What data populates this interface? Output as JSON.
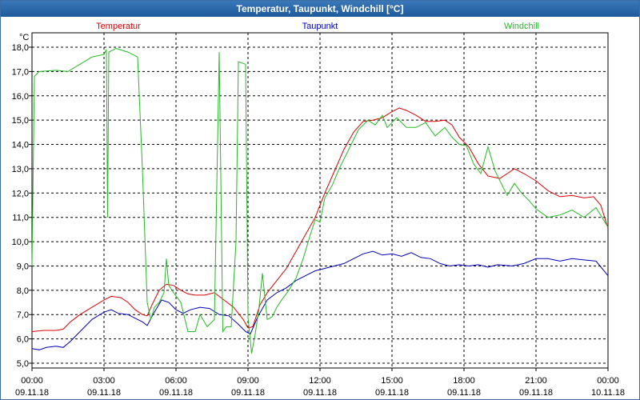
{
  "window": {
    "title": "Temperatur, Taupunkt, Windchill [°C]"
  },
  "chart_data": {
    "type": "line",
    "title": "Temperatur, Taupunkt, Windchill [°C]",
    "ylabel": "°C",
    "xlabel": "",
    "ylim": [
      5.0,
      18.0
    ],
    "xlim": [
      0,
      24
    ],
    "grid": true,
    "legend_placement": "top",
    "y_ticks": [
      "5,0",
      "6,0",
      "7,0",
      "8,0",
      "9,0",
      "10,0",
      "11,0",
      "12,0",
      "13,0",
      "14,0",
      "15,0",
      "16,0",
      "17,0",
      "18,0"
    ],
    "x_ticks": [
      {
        "x": 0,
        "time": "00:00",
        "date": "09.11.18"
      },
      {
        "x": 3,
        "time": "03:00",
        "date": "09.11.18"
      },
      {
        "x": 6,
        "time": "06:00",
        "date": "09.11.18"
      },
      {
        "x": 9,
        "time": "09:00",
        "date": "09.11.18"
      },
      {
        "x": 12,
        "time": "12:00",
        "date": "09.11.18"
      },
      {
        "x": 15,
        "time": "15:00",
        "date": "09.11.18"
      },
      {
        "x": 18,
        "time": "18:00",
        "date": "09.11.18"
      },
      {
        "x": 21,
        "time": "21:00",
        "date": "09.11.18"
      },
      {
        "x": 24,
        "time": "00:00",
        "date": "10.11.18"
      }
    ],
    "series": [
      {
        "name": "Temperatur",
        "color": "#dd0000",
        "points": [
          [
            0,
            6.3
          ],
          [
            0.5,
            6.35
          ],
          [
            1,
            6.35
          ],
          [
            1.3,
            6.4
          ],
          [
            1.6,
            6.7
          ],
          [
            2,
            7.0
          ],
          [
            2.5,
            7.3
          ],
          [
            3,
            7.6
          ],
          [
            3.3,
            7.75
          ],
          [
            3.7,
            7.7
          ],
          [
            4,
            7.5
          ],
          [
            4.3,
            7.2
          ],
          [
            4.6,
            7.0
          ],
          [
            4.8,
            6.95
          ],
          [
            5.0,
            7.4
          ],
          [
            5.3,
            8.0
          ],
          [
            5.6,
            8.25
          ],
          [
            5.9,
            8.2
          ],
          [
            6.2,
            8.0
          ],
          [
            6.5,
            7.85
          ],
          [
            6.8,
            7.8
          ],
          [
            7.2,
            7.8
          ],
          [
            7.6,
            7.9
          ],
          [
            8.0,
            7.6
          ],
          [
            8.4,
            7.3
          ],
          [
            8.8,
            6.8
          ],
          [
            9.0,
            6.45
          ],
          [
            9.2,
            6.5
          ],
          [
            9.5,
            7.4
          ],
          [
            9.8,
            7.9
          ],
          [
            10.2,
            8.4
          ],
          [
            10.6,
            8.9
          ],
          [
            11.0,
            9.6
          ],
          [
            11.4,
            10.3
          ],
          [
            11.8,
            11.0
          ],
          [
            12.2,
            12.0
          ],
          [
            12.6,
            12.9
          ],
          [
            13.0,
            13.8
          ],
          [
            13.4,
            14.5
          ],
          [
            13.8,
            14.95
          ],
          [
            14.2,
            15.0
          ],
          [
            14.6,
            15.1
          ],
          [
            15.0,
            15.35
          ],
          [
            15.3,
            15.5
          ],
          [
            15.6,
            15.4
          ],
          [
            16.0,
            15.2
          ],
          [
            16.4,
            14.95
          ],
          [
            16.8,
            14.95
          ],
          [
            17.2,
            15.0
          ],
          [
            17.5,
            14.8
          ],
          [
            17.8,
            14.3
          ],
          [
            18.2,
            13.9
          ],
          [
            18.6,
            13.2
          ],
          [
            19.0,
            12.7
          ],
          [
            19.5,
            12.6
          ],
          [
            19.8,
            12.8
          ],
          [
            20.1,
            13.0
          ],
          [
            20.5,
            12.8
          ],
          [
            21.0,
            12.5
          ],
          [
            21.5,
            12.1
          ],
          [
            22.0,
            11.85
          ],
          [
            22.5,
            11.9
          ],
          [
            23.0,
            11.8
          ],
          [
            23.4,
            11.85
          ],
          [
            23.7,
            11.5
          ],
          [
            24.0,
            10.55
          ]
        ]
      },
      {
        "name": "Taupunkt",
        "color": "#0000bb",
        "points": [
          [
            0,
            5.6
          ],
          [
            0.3,
            5.55
          ],
          [
            0.6,
            5.65
          ],
          [
            1.0,
            5.7
          ],
          [
            1.3,
            5.65
          ],
          [
            1.6,
            5.9
          ],
          [
            2.0,
            6.3
          ],
          [
            2.5,
            6.8
          ],
          [
            3.0,
            7.1
          ],
          [
            3.3,
            7.2
          ],
          [
            3.6,
            7.05
          ],
          [
            4.0,
            7.0
          ],
          [
            4.3,
            6.85
          ],
          [
            4.6,
            6.7
          ],
          [
            4.8,
            6.55
          ],
          [
            5.1,
            7.1
          ],
          [
            5.4,
            7.6
          ],
          [
            5.7,
            7.5
          ],
          [
            6.0,
            7.2
          ],
          [
            6.3,
            7.05
          ],
          [
            6.6,
            7.2
          ],
          [
            7.0,
            7.3
          ],
          [
            7.4,
            7.25
          ],
          [
            7.8,
            7.0
          ],
          [
            8.2,
            6.95
          ],
          [
            8.6,
            6.6
          ],
          [
            8.9,
            6.3
          ],
          [
            9.1,
            6.2
          ],
          [
            9.4,
            6.9
          ],
          [
            9.8,
            7.6
          ],
          [
            10.2,
            7.9
          ],
          [
            10.6,
            8.1
          ],
          [
            11.0,
            8.4
          ],
          [
            11.4,
            8.6
          ],
          [
            11.8,
            8.8
          ],
          [
            12.2,
            8.9
          ],
          [
            12.6,
            9.0
          ],
          [
            13.0,
            9.1
          ],
          [
            13.4,
            9.3
          ],
          [
            13.8,
            9.5
          ],
          [
            14.2,
            9.6
          ],
          [
            14.6,
            9.45
          ],
          [
            15.0,
            9.5
          ],
          [
            15.4,
            9.4
          ],
          [
            15.8,
            9.55
          ],
          [
            16.2,
            9.35
          ],
          [
            16.6,
            9.3
          ],
          [
            17.0,
            9.1
          ],
          [
            17.4,
            9.0
          ],
          [
            17.8,
            9.05
          ],
          [
            18.2,
            9.0
          ],
          [
            18.6,
            9.05
          ],
          [
            19.0,
            8.95
          ],
          [
            19.4,
            9.05
          ],
          [
            20.0,
            9.0
          ],
          [
            20.5,
            9.1
          ],
          [
            21.0,
            9.3
          ],
          [
            21.5,
            9.3
          ],
          [
            22.0,
            9.2
          ],
          [
            22.5,
            9.3
          ],
          [
            23.0,
            9.25
          ],
          [
            23.5,
            9.2
          ],
          [
            24.0,
            8.6
          ]
        ]
      },
      {
        "name": "Windchill",
        "color": "#22bb22",
        "points": [
          [
            0,
            9.0
          ],
          [
            0.1,
            16.8
          ],
          [
            0.3,
            17.0
          ],
          [
            1.0,
            17.05
          ],
          [
            1.5,
            17.0
          ],
          [
            2.0,
            17.3
          ],
          [
            2.5,
            17.6
          ],
          [
            3.0,
            17.7
          ],
          [
            3.1,
            17.9
          ],
          [
            3.15,
            11.0
          ],
          [
            3.2,
            17.8
          ],
          [
            3.5,
            17.95
          ],
          [
            4.0,
            17.8
          ],
          [
            4.4,
            17.6
          ],
          [
            4.6,
            13.0
          ],
          [
            4.8,
            7.5
          ],
          [
            4.95,
            6.8
          ],
          [
            5.1,
            7.3
          ],
          [
            5.3,
            7.5
          ],
          [
            5.5,
            7.9
          ],
          [
            5.6,
            9.3
          ],
          [
            5.7,
            8.2
          ],
          [
            5.9,
            7.9
          ],
          [
            6.2,
            7.5
          ],
          [
            6.5,
            6.3
          ],
          [
            6.8,
            6.3
          ],
          [
            7.0,
            7.0
          ],
          [
            7.3,
            6.5
          ],
          [
            7.6,
            6.8
          ],
          [
            7.8,
            17.8
          ],
          [
            7.95,
            6.3
          ],
          [
            8.1,
            6.5
          ],
          [
            8.3,
            6.5
          ],
          [
            8.5,
            10.0
          ],
          [
            8.6,
            17.4
          ],
          [
            8.9,
            17.3
          ],
          [
            9.0,
            6.9
          ],
          [
            9.15,
            5.4
          ],
          [
            9.3,
            6.2
          ],
          [
            9.45,
            7.2
          ],
          [
            9.6,
            8.7
          ],
          [
            9.8,
            6.8
          ],
          [
            10.0,
            6.9
          ],
          [
            10.2,
            7.3
          ],
          [
            10.4,
            7.6
          ],
          [
            10.7,
            8.0
          ],
          [
            11.0,
            8.5
          ],
          [
            11.3,
            9.3
          ],
          [
            11.6,
            10.3
          ],
          [
            11.8,
            10.9
          ],
          [
            12.0,
            10.8
          ],
          [
            12.2,
            11.8
          ],
          [
            12.5,
            12.3
          ],
          [
            12.8,
            13.0
          ],
          [
            13.2,
            13.8
          ],
          [
            13.6,
            14.6
          ],
          [
            14.0,
            15.0
          ],
          [
            14.3,
            14.8
          ],
          [
            14.6,
            15.2
          ],
          [
            14.8,
            14.7
          ],
          [
            15.0,
            14.9
          ],
          [
            15.2,
            15.1
          ],
          [
            15.6,
            14.7
          ],
          [
            16.0,
            14.7
          ],
          [
            16.4,
            14.9
          ],
          [
            16.8,
            14.35
          ],
          [
            17.2,
            14.7
          ],
          [
            17.5,
            14.3
          ],
          [
            17.8,
            14.0
          ],
          [
            18.1,
            13.95
          ],
          [
            18.4,
            13.2
          ],
          [
            18.7,
            12.8
          ],
          [
            19.0,
            13.9
          ],
          [
            19.3,
            12.9
          ],
          [
            19.6,
            12.3
          ],
          [
            19.8,
            11.9
          ],
          [
            20.1,
            12.4
          ],
          [
            20.4,
            12.0
          ],
          [
            20.7,
            11.7
          ],
          [
            21.0,
            11.35
          ],
          [
            21.5,
            11.0
          ],
          [
            22.0,
            11.1
          ],
          [
            22.5,
            11.3
          ],
          [
            23.0,
            11.0
          ],
          [
            23.5,
            11.4
          ],
          [
            24.0,
            10.6
          ]
        ]
      }
    ]
  }
}
